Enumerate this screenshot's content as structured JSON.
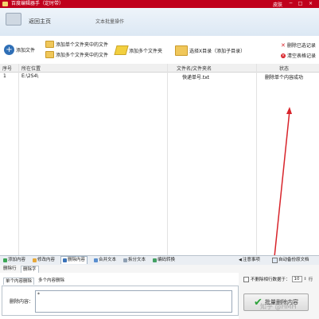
{
  "window": {
    "title": "百度编辑器手（定时带）",
    "skin_label": "皮肤",
    "controls": {
      "minimize": "─",
      "maximize": "□",
      "close": "×"
    }
  },
  "nav": {
    "home_label": "返回主页",
    "section_label": "文本批量操作"
  },
  "toolbar": {
    "add_file": "添加文件",
    "add_single_folder_files": "添加单个文件夹中的文件",
    "add_multi_folder_files": "添加多个文件夹中的文件",
    "add_multi_folders": "添加多个文件夹",
    "select_x_dir": "选择X目录（添加子目录）",
    "delete_selected": "删除已选记录",
    "clear_all": "清空表格记录"
  },
  "table": {
    "headers": {
      "index": "序号",
      "location": "所在位置",
      "filename": "文件名/文件夹名",
      "status": "状态"
    },
    "rows": [
      {
        "index": "1",
        "location": "E:\\2S4\\",
        "filename": "快递单号.txt",
        "status": "删除单个内容成功"
      }
    ]
  },
  "bottom_tabs": [
    "添加内容",
    "修改内容",
    "删除内容",
    "合并文本",
    "拆分文本",
    "编码转换"
  ],
  "bottom_tabs_right": {
    "notes": "注意事项",
    "auto_backup": "自动备份原文档"
  },
  "sub_tabs": [
    "删除行",
    "删除字"
  ],
  "sub_tabs2": [
    "单个内容删除",
    "多个内容删除"
  ],
  "delete_panel": {
    "content_label": "删除内容：",
    "content_value": "*"
  },
  "right_panel": {
    "checkbox_label": "不删除相行数据于：",
    "count_value": "10",
    "count_unit": "行",
    "delete_button": "批量删除内容"
  },
  "watermark": "知乎 @HMH",
  "colors": {
    "titlebar": "#c0001c",
    "arrow": "#d8242b",
    "accent": "#2f6fb6"
  },
  "icons": [
    "app-icon",
    "home-icon",
    "add-file-icon",
    "folder-icon",
    "select-dir-icon",
    "delete-x-icon",
    "clear-icon",
    "green-check-icon"
  ]
}
